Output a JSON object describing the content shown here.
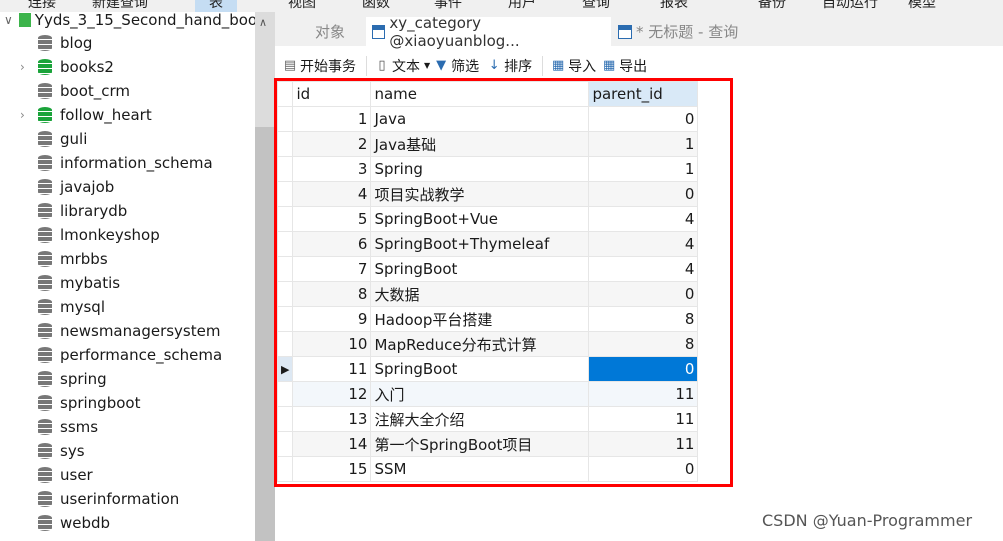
{
  "menu": [
    "连接",
    "新建查询",
    "表",
    "视图",
    "函数",
    "事件",
    "用户",
    "查询",
    "报表",
    "备份",
    "自动运行",
    "模型"
  ],
  "sidebar": {
    "connection": "Yyds_3_15_Second_hand_boo",
    "databases": [
      {
        "name": "blog",
        "expandable": false,
        "open": false
      },
      {
        "name": "books2",
        "expandable": true,
        "open": true
      },
      {
        "name": "boot_crm",
        "expandable": false,
        "open": false
      },
      {
        "name": "follow_heart",
        "expandable": true,
        "open": true
      },
      {
        "name": "guli",
        "expandable": false,
        "open": false
      },
      {
        "name": "information_schema",
        "expandable": false,
        "open": false
      },
      {
        "name": "javajob",
        "expandable": false,
        "open": false
      },
      {
        "name": "librarydb",
        "expandable": false,
        "open": false
      },
      {
        "name": "lmonkeyshop",
        "expandable": false,
        "open": false
      },
      {
        "name": "mrbbs",
        "expandable": false,
        "open": false
      },
      {
        "name": "mybatis",
        "expandable": false,
        "open": false
      },
      {
        "name": "mysql",
        "expandable": false,
        "open": false
      },
      {
        "name": "newsmanagersystem",
        "expandable": false,
        "open": false
      },
      {
        "name": "performance_schema",
        "expandable": false,
        "open": false
      },
      {
        "name": "spring",
        "expandable": false,
        "open": false
      },
      {
        "name": "springboot",
        "expandable": false,
        "open": false
      },
      {
        "name": "ssms",
        "expandable": false,
        "open": false
      },
      {
        "name": "sys",
        "expandable": false,
        "open": false
      },
      {
        "name": "user",
        "expandable": false,
        "open": false
      },
      {
        "name": "userinformation",
        "expandable": false,
        "open": false
      },
      {
        "name": "webdb",
        "expandable": false,
        "open": false
      }
    ]
  },
  "tabs": {
    "objects": "对象",
    "table": "xy_category @xiaoyuanblog...",
    "query": "* 无标题 - 查询"
  },
  "toolbar": {
    "begin_tx": "开始事务",
    "text": "文本",
    "filter": "筛选",
    "sort": "排序",
    "import": "导入",
    "export": "导出"
  },
  "grid": {
    "columns": [
      "id",
      "name",
      "parent_id"
    ],
    "selected_row": 11,
    "rows": [
      [
        1,
        "Java",
        0
      ],
      [
        2,
        "Java基础",
        1
      ],
      [
        3,
        "Spring",
        1
      ],
      [
        4,
        "项目实战教学",
        0
      ],
      [
        5,
        "SpringBoot+Vue",
        4
      ],
      [
        6,
        "SpringBoot+Thymeleaf",
        4
      ],
      [
        7,
        "SpringBoot",
        4
      ],
      [
        8,
        "大数据",
        0
      ],
      [
        9,
        "Hadoop平台搭建",
        8
      ],
      [
        10,
        "MapReduce分布式计算",
        8
      ],
      [
        11,
        "SpringBoot",
        0
      ],
      [
        12,
        "入门",
        11
      ],
      [
        13,
        "注解大全介绍",
        11
      ],
      [
        14,
        "第一个SpringBoot项目",
        11
      ],
      [
        15,
        "SSM",
        0
      ]
    ]
  },
  "watermark": "CSDN @Yuan-Programmer",
  "colors": {
    "selection": "#0078d7",
    "highlight_box": "#ff0000",
    "db_open": "#1aa33a"
  }
}
